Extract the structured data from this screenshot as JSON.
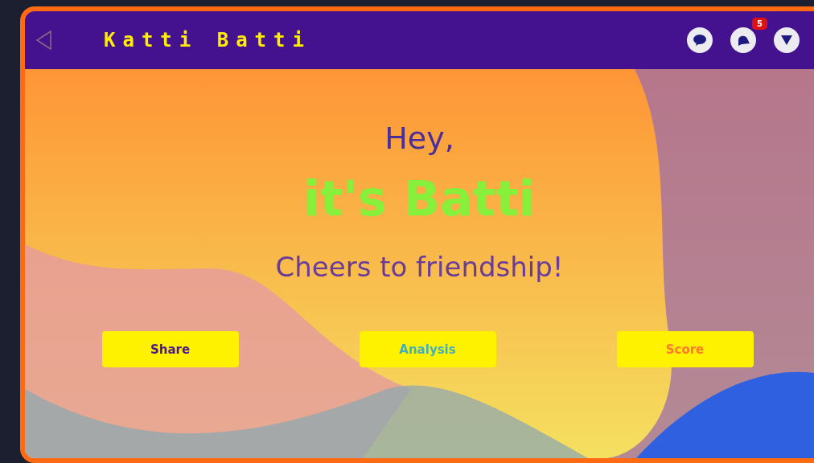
{
  "header": {
    "title": "Katti Batti",
    "notification_count": "5"
  },
  "greeting": {
    "line_1": "Hey,",
    "name": "it's Batti",
    "tagline": "Cheers to friendship!"
  },
  "buttons": [
    {
      "label": "Share",
      "kind": "primary"
    },
    {
      "label": "Analysis",
      "kind": "info"
    },
    {
      "label": "Score",
      "kind": "accent"
    }
  ]
}
